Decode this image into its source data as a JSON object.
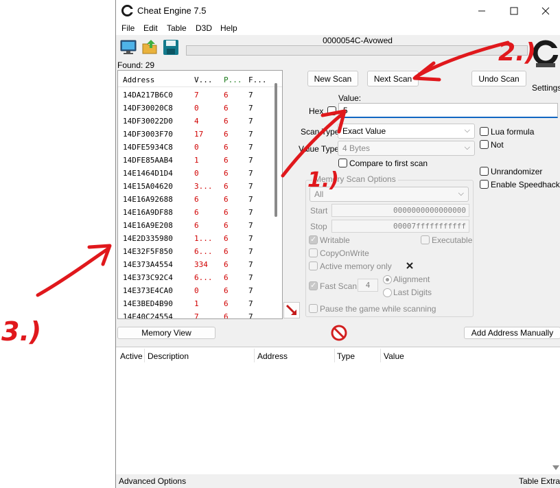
{
  "window": {
    "title": "Cheat Engine 7.5",
    "process": "0000054C-Avowed",
    "progress": 0
  },
  "menu": [
    "File",
    "Edit",
    "Table",
    "D3D",
    "Help"
  ],
  "found": "Found: 29",
  "settings_label": "Settings",
  "results": {
    "headers": [
      "Address",
      "V...",
      "P...",
      "F..."
    ],
    "rows": [
      [
        "14DA217B6C0",
        "7",
        "6",
        "7"
      ],
      [
        "14DF30020C8",
        "0",
        "6",
        "7"
      ],
      [
        "14DF30022D0",
        "4",
        "6",
        "7"
      ],
      [
        "14DF3003F70",
        "17",
        "6",
        "7"
      ],
      [
        "14DFE5934C8",
        "0",
        "6",
        "7"
      ],
      [
        "14DFE85AAB4",
        "1",
        "6",
        "7"
      ],
      [
        "14E1464D1D4",
        "0",
        "6",
        "7"
      ],
      [
        "14E15A04620",
        "3...",
        "6",
        "7"
      ],
      [
        "14E16A92688",
        "6",
        "6",
        "7"
      ],
      [
        "14E16A9DF88",
        "6",
        "6",
        "7"
      ],
      [
        "14E16A9E208",
        "6",
        "6",
        "7"
      ],
      [
        "14E2D335980",
        "1...",
        "6",
        "7"
      ],
      [
        "14E32F5F850",
        "6...",
        "6",
        "7"
      ],
      [
        "14E373A4554",
        "334",
        "6",
        "7"
      ],
      [
        "14E373C92C4",
        "6...",
        "6",
        "7"
      ],
      [
        "14E373E4CA0",
        "0",
        "6",
        "7"
      ],
      [
        "14E3BED4B90",
        "1",
        "6",
        "7"
      ],
      [
        "14E40C24554",
        "7",
        "6",
        "7"
      ]
    ]
  },
  "scan": {
    "new_scan": "New Scan",
    "next_scan": "Next Scan",
    "undo_scan": "Undo Scan",
    "value_label": "Value:",
    "hex_label": "Hex",
    "value": "5",
    "scan_type_label": "Scan Type",
    "scan_type": "Exact Value",
    "value_type_label": "Value Type",
    "value_type": "4 Bytes",
    "compare_first": "Compare to first scan",
    "lua_formula": "Lua formula",
    "not": "Not",
    "unrandomizer": "Unrandomizer",
    "speedhack": "Enable Speedhack"
  },
  "memory_options": {
    "title": "Memory Scan Options",
    "region": "All",
    "start_label": "Start",
    "start": "0000000000000000",
    "stop_label": "Stop",
    "stop": "00007fffffffffff",
    "writable": "Writable",
    "executable": "Executable",
    "copy_on_write": "CopyOnWrite",
    "active_memory": "Active memory only",
    "fast_scan": "Fast Scan",
    "fast_scan_value": "4",
    "alignment": "Alignment",
    "last_digits": "Last Digits",
    "pause": "Pause the game while scanning"
  },
  "memory_view": "Memory View",
  "add_address": "Add Address Manually",
  "table": {
    "columns": [
      "Active",
      "Description",
      "Address",
      "Type",
      "Value"
    ]
  },
  "status": {
    "left": "Advanced Options",
    "right": "Table Extras"
  },
  "annotations": {
    "one": "1.)",
    "two": "2.)",
    "three": "3.)"
  },
  "colors": {
    "annotation": "#e0181c",
    "value_red": "#d00000",
    "progress_green": "#06b025",
    "focus_blue": "#1066c2"
  }
}
